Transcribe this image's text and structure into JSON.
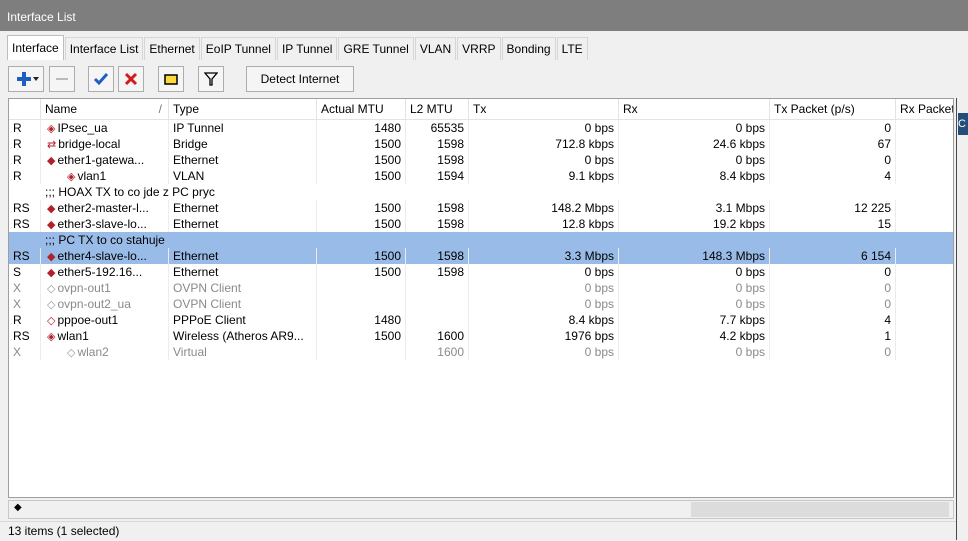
{
  "window": {
    "title": "Interface List"
  },
  "tabs": [
    "Interface",
    "Interface List",
    "Ethernet",
    "EoIP Tunnel",
    "IP Tunnel",
    "GRE Tunnel",
    "VLAN",
    "VRRP",
    "Bonding",
    "LTE"
  ],
  "toolbar": {
    "detect_label": "Detect Internet"
  },
  "columns": {
    "flags": "",
    "name": "Name",
    "sort": "/",
    "type": "Type",
    "actual_mtu": "Actual MTU",
    "l2mtu": "L2 MTU",
    "tx": "Tx",
    "rx": "Rx",
    "tx_packet": "Tx Packet (p/s)",
    "rx_packet": "Rx Packet ("
  },
  "rows": [
    {
      "flags": "R",
      "icon": "◈",
      "indent": 0,
      "name": "IPsec_ua",
      "type": "IP Tunnel",
      "actual_mtu": "1480",
      "l2mtu": "65535",
      "tx": "0 bps",
      "rx": "0 bps",
      "tx_packet": "0"
    },
    {
      "flags": "R",
      "icon": "⇄",
      "indent": 0,
      "name": "bridge-local",
      "type": "Bridge",
      "actual_mtu": "1500",
      "l2mtu": "1598",
      "tx": "712.8 kbps",
      "rx": "24.6 kbps",
      "tx_packet": "67"
    },
    {
      "flags": "R",
      "icon": "◆",
      "indent": 0,
      "name": "ether1-gatewa...",
      "type": "Ethernet",
      "actual_mtu": "1500",
      "l2mtu": "1598",
      "tx": "0 bps",
      "rx": "0 bps",
      "tx_packet": "0"
    },
    {
      "flags": "R",
      "icon": "◈",
      "indent": 1,
      "name": "vlan1",
      "type": "VLAN",
      "actual_mtu": "1500",
      "l2mtu": "1594",
      "tx": "9.1 kbps",
      "rx": "8.4 kbps",
      "tx_packet": "4"
    },
    {
      "comment": ";;; HOAX TX to co jde z PC pryc"
    },
    {
      "flags": "RS",
      "icon": "◆",
      "indent": 0,
      "name": "ether2-master-l...",
      "type": "Ethernet",
      "actual_mtu": "1500",
      "l2mtu": "1598",
      "tx": "148.2 Mbps",
      "rx": "3.1 Mbps",
      "tx_packet": "12 225"
    },
    {
      "flags": "RS",
      "icon": "◆",
      "indent": 0,
      "name": "ether3-slave-lo...",
      "type": "Ethernet",
      "actual_mtu": "1500",
      "l2mtu": "1598",
      "tx": "12.8 kbps",
      "rx": "19.2 kbps",
      "tx_packet": "15"
    },
    {
      "comment": ";;; PC TX to co stahuje",
      "selected": true
    },
    {
      "flags": "RS",
      "icon": "◆",
      "indent": 0,
      "name": "ether4-slave-lo...",
      "type": "Ethernet",
      "actual_mtu": "1500",
      "l2mtu": "1598",
      "tx": "3.3 Mbps",
      "rx": "148.3 Mbps",
      "tx_packet": "6 154",
      "selected": true
    },
    {
      "flags": "S",
      "icon": "◆",
      "indent": 0,
      "name": "ether5-192.16...",
      "type": "Ethernet",
      "actual_mtu": "1500",
      "l2mtu": "1598",
      "tx": "0 bps",
      "rx": "0 bps",
      "tx_packet": "0"
    },
    {
      "flags": "X",
      "icon": "◇",
      "indent": 0,
      "name": "ovpn-out1",
      "type": "OVPN Client",
      "actual_mtu": "",
      "l2mtu": "",
      "tx": "0 bps",
      "rx": "0 bps",
      "tx_packet": "0",
      "disabled": true
    },
    {
      "flags": "X",
      "icon": "◇",
      "indent": 0,
      "name": "ovpn-out2_ua",
      "type": "OVPN Client",
      "actual_mtu": "",
      "l2mtu": "",
      "tx": "0 bps",
      "rx": "0 bps",
      "tx_packet": "0",
      "disabled": true
    },
    {
      "flags": "R",
      "icon": "◇",
      "indent": 0,
      "name": "pppoe-out1",
      "type": "PPPoE Client",
      "actual_mtu": "1480",
      "l2mtu": "",
      "tx": "8.4 kbps",
      "rx": "7.7 kbps",
      "tx_packet": "4"
    },
    {
      "flags": "RS",
      "icon": "◈",
      "indent": 0,
      "name": "wlan1",
      "type": "Wireless (Atheros AR9...",
      "actual_mtu": "1500",
      "l2mtu": "1600",
      "tx": "1976 bps",
      "rx": "4.2 kbps",
      "tx_packet": "1"
    },
    {
      "flags": "X",
      "icon": "◇",
      "indent": 1,
      "name": "wlan2",
      "type": "Virtual",
      "actual_mtu": "",
      "l2mtu": "1600",
      "tx": "0 bps",
      "rx": "0 bps",
      "tx_packet": "0",
      "disabled": true
    }
  ],
  "scroll": {
    "left_arrow": "◆"
  },
  "status": {
    "text": "13 items (1 selected)"
  },
  "side_window": {
    "label": "C"
  },
  "colors": {
    "titlebar": "#7e7e7e",
    "selected_row": "#99bbe8",
    "add_icon": "#1f5fbf",
    "check_icon": "#1f5fbf",
    "remove_icon": "#d21c1c"
  }
}
